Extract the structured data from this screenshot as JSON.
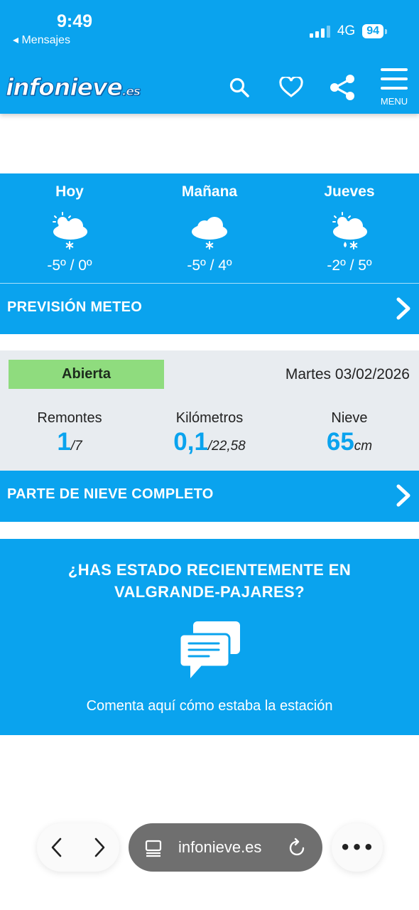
{
  "status_bar": {
    "time": "9:49",
    "back_label": "◂ Mensajes",
    "network": "4G",
    "battery": "94"
  },
  "header": {
    "logo_main": "infonieve",
    "logo_suffix": ".es",
    "menu_label": "MENU"
  },
  "forecast": {
    "days": [
      {
        "name": "Hoy",
        "temp": "-5º / 0º",
        "icon": "sun-cloud-snow-icon"
      },
      {
        "name": "Mañana",
        "temp": "-5º / 4º",
        "icon": "cloud-snow-icon"
      },
      {
        "name": "Jueves",
        "temp": "-2º / 5º",
        "icon": "sun-cloud-rain-snow-icon"
      }
    ],
    "link_label": "PREVISIÓN METEO"
  },
  "report": {
    "status": "Abierta",
    "date": "Martes 03/02/2026",
    "lifts": {
      "label": "Remontes",
      "value": "1",
      "total": "/7"
    },
    "km": {
      "label": "Kilómetros",
      "value": "0,1",
      "total": "/22,58"
    },
    "snow": {
      "label": "Nieve",
      "value": "65",
      "unit": "cm"
    },
    "link_label": "PARTE DE NIEVE COMPLETO"
  },
  "cta": {
    "title_line1": "¿HAS ESTADO RECIENTEMENTE EN",
    "title_line2": "VALGRANDE-PAJARES?",
    "subtitle": "Comenta aquí cómo estaba la estación"
  },
  "browser": {
    "url": "infonieve.es",
    "more": "•••"
  },
  "colors": {
    "brand": "#0aa3ee",
    "open_badge": "#8fdc7e",
    "report_bg": "#e8ecf0"
  }
}
